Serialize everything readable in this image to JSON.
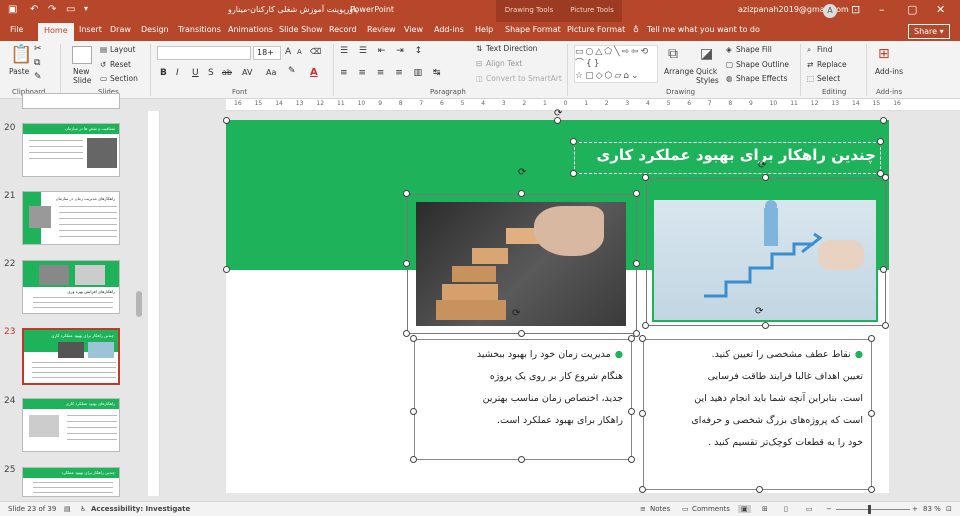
{
  "window": {
    "title": "پاورپوینت آموزش شغلی کارکنان-مینارو",
    "app": "PowerPoint",
    "user_email": "azizpanah2019@gmail.com",
    "avatar_letter": "A"
  },
  "context_tabs": {
    "drawing": "Drawing Tools",
    "picture": "Picture Tools"
  },
  "tabs": [
    "File",
    "Home",
    "Insert",
    "Draw",
    "Design",
    "Transitions",
    "Animations",
    "Slide Show",
    "Record",
    "Review",
    "View",
    "Add-ins",
    "Help",
    "Shape Format",
    "Picture Format"
  ],
  "tell_me": "Tell me what you want to do",
  "share": "Share",
  "ribbon": {
    "clipboard": {
      "label": "Clipboard",
      "paste": "Paste"
    },
    "slides": {
      "label": "Slides",
      "new_slide": "New Slide",
      "layout": "Layout",
      "reset": "Reset",
      "section": "Section"
    },
    "font": {
      "label": "Font",
      "size": "18+",
      "bold": "B",
      "italic": "I",
      "underline": "U",
      "strike": "S",
      "abc": "ab",
      "shadow": "S",
      "av": "AV",
      "aa": "Aa",
      "grow": "A",
      "shrink": "A",
      "color": "A"
    },
    "paragraph": {
      "label": "Paragraph",
      "text_direction": "Text Direction",
      "align_text": "Align Text",
      "smartart": "Convert to SmartArt"
    },
    "drawing": {
      "label": "Drawing",
      "arrange": "Arrange",
      "quick_styles": "Quick Styles",
      "fill": "Shape Fill",
      "outline": "Shape Outline",
      "effects": "Shape Effects"
    },
    "editing": {
      "label": "Editing",
      "find": "Find",
      "replace": "Replace",
      "select": "Select"
    },
    "addins": {
      "label": "Add-ins",
      "btn": "Add-ins"
    }
  },
  "ruler_ticks": [
    "16",
    "15",
    "14",
    "13",
    "12",
    "11",
    "10",
    "9",
    "8",
    "7",
    "6",
    "5",
    "4",
    "3",
    "2",
    "1",
    "0",
    "1",
    "2",
    "3",
    "4",
    "5",
    "6",
    "7",
    "8",
    "9",
    "10",
    "11",
    "12",
    "13",
    "14",
    "15",
    "16"
  ],
  "slides": [
    {
      "num": "20",
      "title": "شفافیت و نقش ها در سازمان"
    },
    {
      "num": "21",
      "title": "راهکارهای مدیریت زمان در سازمان"
    },
    {
      "num": "22",
      "title": "راهکارهای افزایش بهره وری"
    },
    {
      "num": "23",
      "title": "چندین راهکار برای بهبود عملکرد کاری"
    },
    {
      "num": "24",
      "title": "راهکارهای بهبود عملکرد کاری"
    },
    {
      "num": "25",
      "title": "چندین راهکار برای بهبود عملکرد"
    }
  ],
  "slide": {
    "title": "چندین راهکار برای بهبود عملکرد کاری",
    "left_text": [
      "مدیریت زمان خود را بهبود ببخشید",
      "هنگام شروع کار بر روی یک پروژه",
      "جدید، اختصاص زمان مناسب بهترین",
      "راهکار برای بهبود عملکرد است."
    ],
    "right_text": [
      "نقاط عطف مشخصی را تعیین کنید.",
      "تعیین اهداف غالبا فرایند طاقت فرسایی",
      "است. بنابراین آنچه شما باید انجام دهید این",
      "است که پروژه‌های بزرگ شخصی و حرفه‌ای",
      "خود را به قطعات کوچک‌تر تقسیم کنید ."
    ],
    "bullet": "●"
  },
  "colors": {
    "accent": "#b7472a",
    "green": "#1eb35a"
  },
  "status": {
    "slide": "Slide 23 of 39",
    "accessibility": "Accessibility: Investigate",
    "notes": "Notes",
    "comments": "Comments",
    "zoom": "83 %",
    "minus": "−",
    "plus": "+"
  }
}
